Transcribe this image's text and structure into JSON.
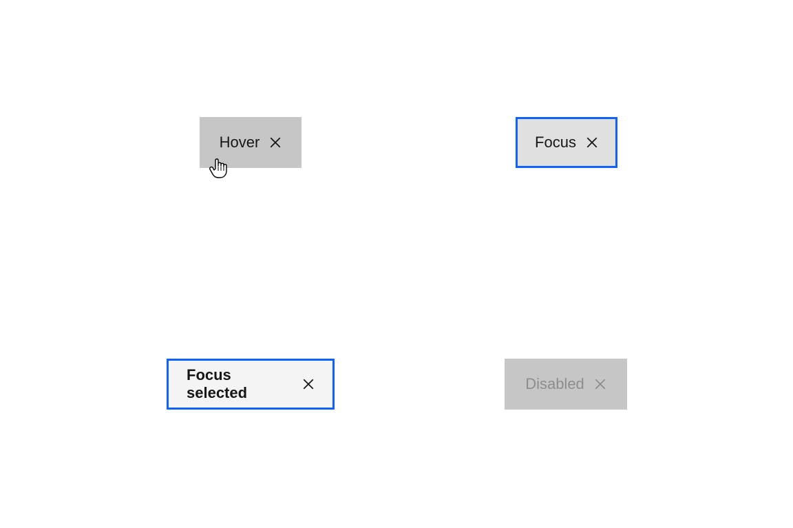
{
  "tabs": {
    "hover": {
      "label": "Hover"
    },
    "focus": {
      "label": "Focus"
    },
    "focus_selected": {
      "label": "Focus selected"
    },
    "disabled": {
      "label": "Disabled"
    }
  }
}
